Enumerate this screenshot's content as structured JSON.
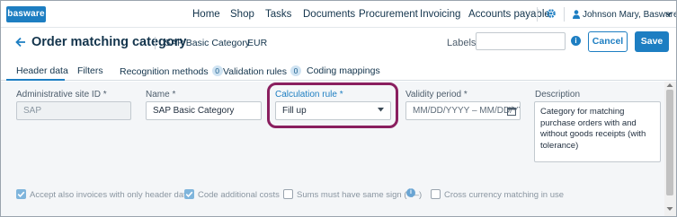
{
  "brand": {
    "logo_text": "basware",
    "accent": "#1d7ec2",
    "highlight": "#8a1f5f"
  },
  "topnav": {
    "items": [
      "Home",
      "Shop",
      "Tasks",
      "Documents",
      "Procurement",
      "Invoicing",
      "Accounts payable"
    ],
    "settings_icon": "gear-icon",
    "user": "Johnson Mary, Basware Oyj"
  },
  "header": {
    "title": "Order matching category",
    "category": "SAP Basic Category",
    "currency": "EUR",
    "labels_text": "Labels:",
    "labels_value": "",
    "cancel_label": "Cancel",
    "save_label": "Save"
  },
  "tabs": [
    {
      "label": "Header data",
      "badge": ""
    },
    {
      "label": "Filters",
      "badge": ""
    },
    {
      "label": "Recognition methods",
      "badge": "0"
    },
    {
      "label": "Validation rules",
      "badge": "0"
    },
    {
      "label": "Coding mappings",
      "badge": ""
    }
  ],
  "form": {
    "admin_site": {
      "label": "Administrative site ID *",
      "value": "SAP"
    },
    "name": {
      "label": "Name *",
      "value": "SAP Basic Category"
    },
    "calc_rule": {
      "label": "Calculation rule *",
      "value": "Fill up"
    },
    "validity": {
      "label": "Validity period *",
      "placeholder": "MM/DD/YYYY – MM/DD/YYYY"
    },
    "description": {
      "label": "Description",
      "value": "Category for matching purchase orders with and without goods receipts (with tolerance)"
    }
  },
  "checkboxes": [
    {
      "label": "Accept also invoices with only header data",
      "checked": true
    },
    {
      "label": "Code additional costs",
      "checked": true
    },
    {
      "label": "Sums must have same sign (+/–)",
      "checked": false
    },
    {
      "label": "Cross currency matching in use",
      "checked": false
    }
  ]
}
